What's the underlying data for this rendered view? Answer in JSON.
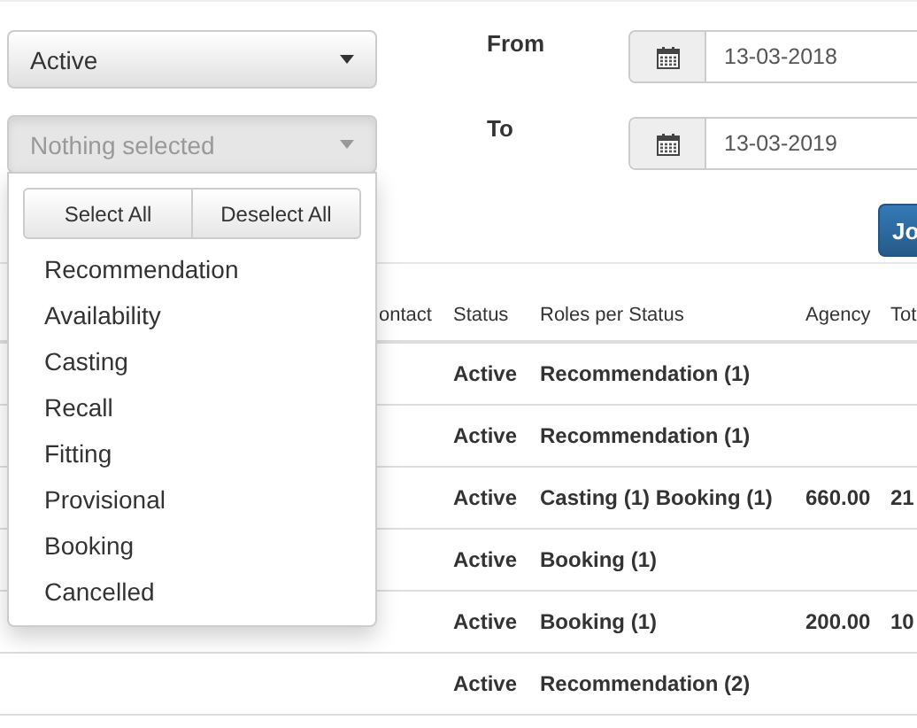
{
  "filters": {
    "status_select": {
      "value": "Active"
    },
    "roles_select": {
      "placeholder": "Nothing selected",
      "expanded": true
    },
    "roles_menu": {
      "actions": [
        "Select All",
        "Deselect All"
      ],
      "options": [
        {
          "label": "Recommendation"
        },
        {
          "label": "Availability"
        },
        {
          "label": "Casting"
        },
        {
          "label": "Recall"
        },
        {
          "label": "Fitting"
        },
        {
          "label": "Provisional"
        },
        {
          "label": "Booking"
        },
        {
          "label": "Cancelled"
        }
      ]
    },
    "date_from": {
      "label": "From",
      "value": "13-03-2018"
    },
    "date_to": {
      "label": "To",
      "value": "13-03-2019"
    },
    "button": {
      "label": "Jo"
    }
  },
  "table": {
    "columns": [
      "ontact",
      "Status",
      "Roles per Status",
      "Agency",
      "Tot"
    ],
    "rows": [
      {
        "status": "Active",
        "roles": "Recommendation (1)"
      },
      {
        "status": "Active",
        "roles": "Recommendation (1)"
      },
      {
        "status": "Active",
        "roles": "Casting (1) Booking (1)",
        "agency": "660.00",
        "total": "21"
      },
      {
        "status": "Active",
        "roles": "Booking (1)"
      },
      {
        "status": "Active",
        "roles": "Booking (1)",
        "agency": "200.00",
        "total": "10"
      },
      {
        "status": "Active",
        "roles": "Recommendation (2)"
      }
    ]
  }
}
